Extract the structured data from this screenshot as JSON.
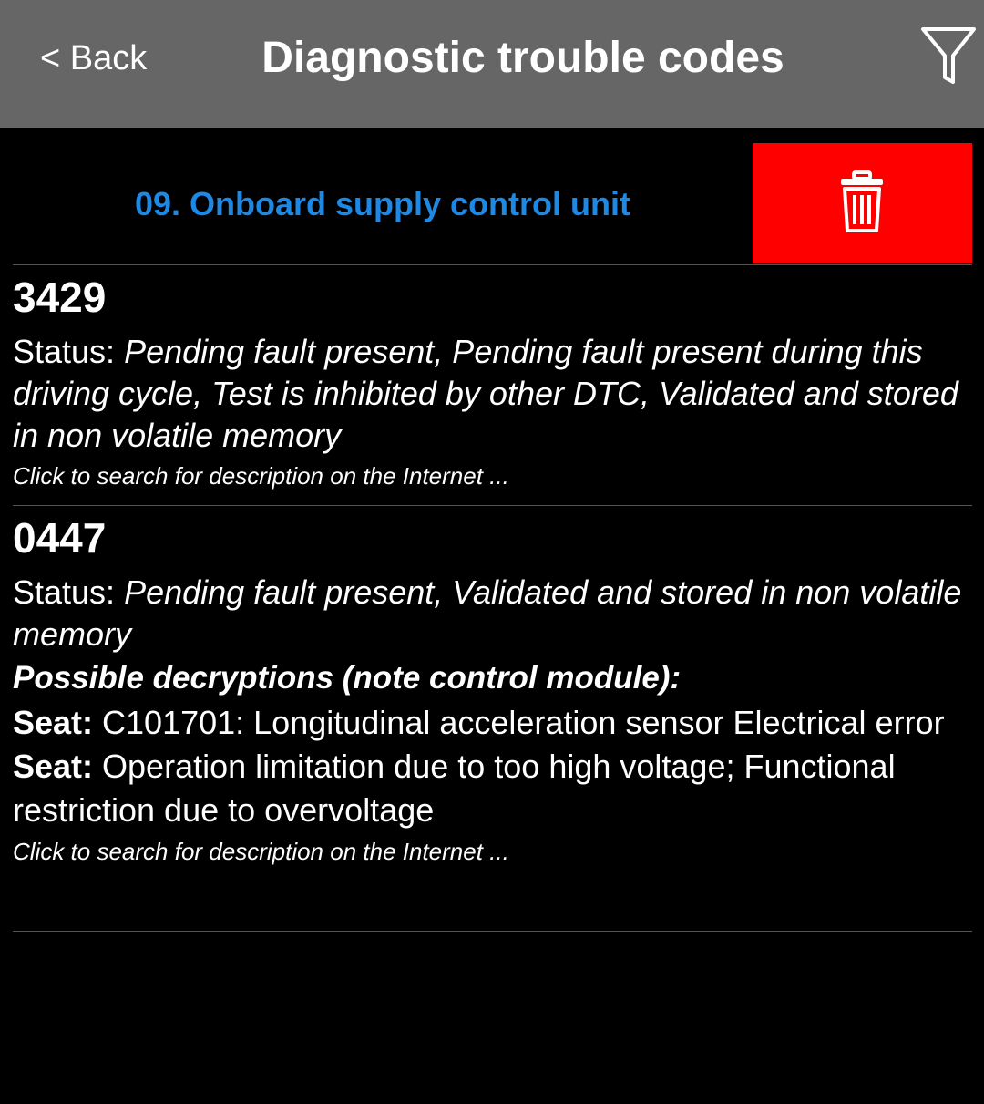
{
  "header": {
    "back_label": "< Back",
    "title": "Diagnostic trouble codes",
    "filter_icon": "filter-icon"
  },
  "module": {
    "name": "09. Onboard supply control unit",
    "delete_icon": "trash-icon"
  },
  "colors": {
    "header_bg": "#666666",
    "background": "#000000",
    "module_name": "#1e88e5",
    "delete_bg": "#ff0000",
    "text": "#ffffff"
  },
  "dtcs": [
    {
      "code": "3429",
      "status_label": "Status: ",
      "status_value": "Pending fault present, Pending fault present during this driving cycle, Test is inhibited by other DTC, Validated and stored in non volatile memory",
      "search_link": "Click to search for description on the Internet ..."
    },
    {
      "code": "0447",
      "status_label": "Status: ",
      "status_value": "Pending fault present, Validated and stored in non volatile memory",
      "decryptions_heading": "Possible decryptions (note control module):",
      "decryptions": [
        {
          "label": "Seat:",
          "text": " C101701: Longitudinal acceleration sensor Electrical error"
        },
        {
          "label": "Seat:",
          "text": " Operation limitation due to too high voltage; Functional restriction due to overvoltage"
        }
      ],
      "search_link": "Click to search for description on the Internet ..."
    }
  ]
}
